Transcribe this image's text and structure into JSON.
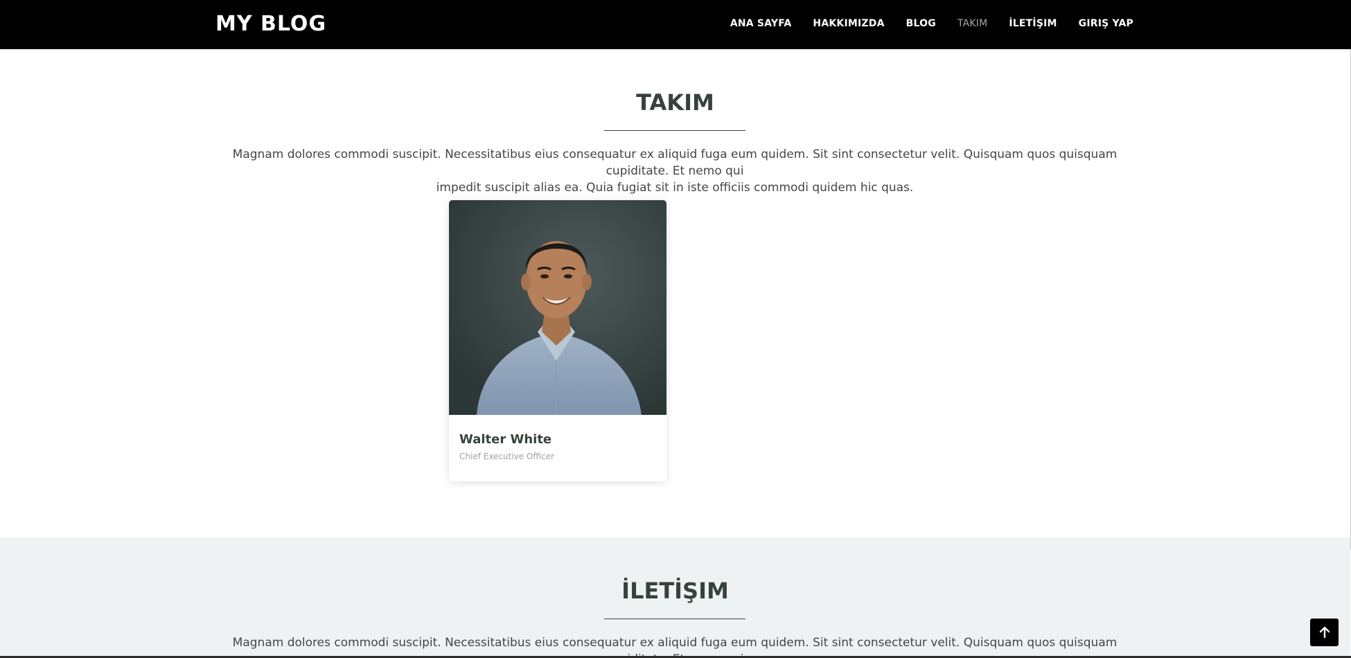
{
  "header": {
    "logo": "MY BLOG",
    "nav": [
      {
        "label": "ANA SAYFA"
      },
      {
        "label": "HAKKIMIZDA"
      },
      {
        "label": "BLOG"
      },
      {
        "label": "TAKIM",
        "active": true
      },
      {
        "label": "İLETİŞIM"
      },
      {
        "label": "GIRIŞ YAP"
      }
    ]
  },
  "team": {
    "title": "TAKIM",
    "description_line1": "Magnam dolores commodi suscipit. Necessitatibus eius consequatur ex aliquid fuga eum quidem. Sit sint consectetur velit. Quisquam quos quisquam cupiditate. Et nemo qui",
    "description_line2": "impedit suscipit alias ea. Quia fugiat sit in iste officiis commodi quidem hic quas.",
    "members": [
      {
        "name": "Walter White",
        "role": "Chief Executive Officer"
      }
    ]
  },
  "contact": {
    "title": "İLETİŞIM",
    "description_line1": "Magnam dolores commodi suscipit. Necessitatibus eius consequatur ex aliquid fuga eum quidem. Sit sint consectetur velit. Quisquam quos quisquam cupiditate. Et nemo qui"
  },
  "icons": {
    "back_to_top": "arrow-up-icon"
  },
  "colors": {
    "header_bg": "#000000",
    "heading": "#37423b",
    "nav_active": "#a7a7a7",
    "contact_bg": "#eff2f3"
  }
}
